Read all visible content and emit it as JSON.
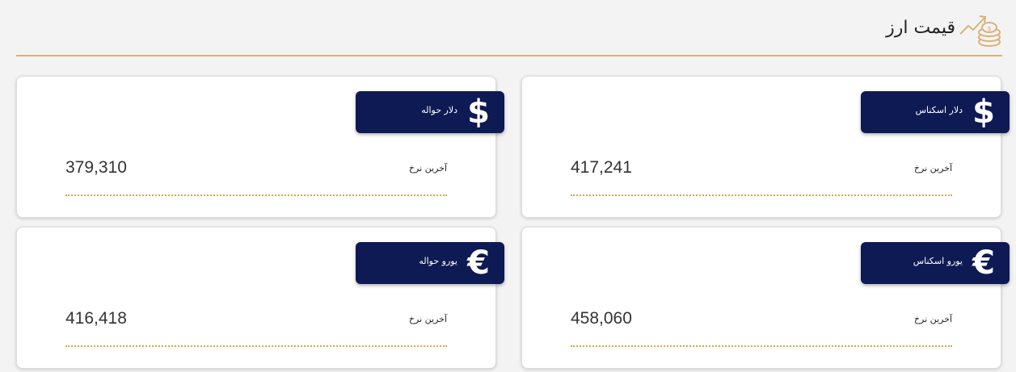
{
  "header": {
    "title": "قیمت ارز",
    "icon": "rising-coins-icon",
    "accent_color": "#d9b277"
  },
  "cards": [
    {
      "symbol": "$",
      "label": "دلار اسکناس",
      "rate_label": "آخرین نرخ",
      "value": "417,241",
      "icon": "dollar-icon"
    },
    {
      "symbol": "$",
      "label": "دلار حواله",
      "rate_label": "آخرین نرخ",
      "value": "379,310",
      "icon": "dollar-icon"
    },
    {
      "symbol": "€",
      "label": "یورو اسکناس",
      "rate_label": "آخرین نرخ",
      "value": "458,060",
      "icon": "euro-icon"
    },
    {
      "symbol": "€",
      "label": "یورو حواله",
      "rate_label": "آخرین نرخ",
      "value": "416,418",
      "icon": "euro-icon"
    }
  ],
  "colors": {
    "badge_background": "#0d1a54",
    "divider": "#d9a74a"
  }
}
